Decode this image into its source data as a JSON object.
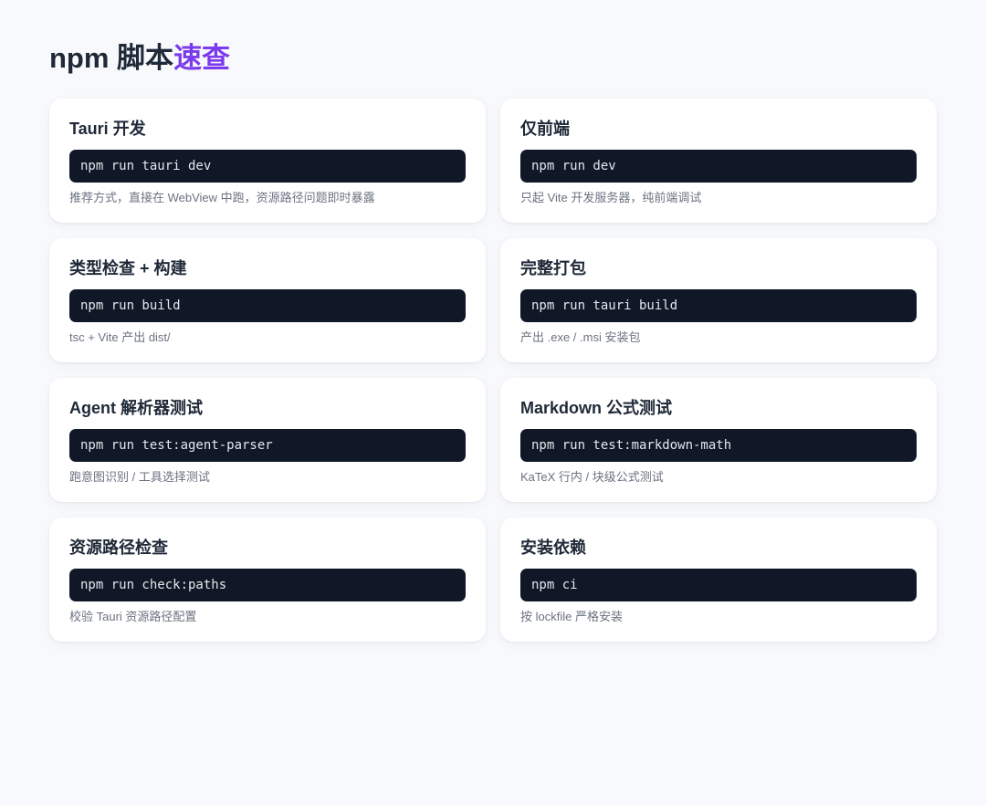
{
  "header": {
    "title_main": "npm 脚本",
    "title_accent": "速查"
  },
  "colors": {
    "accent": "#7c3aed",
    "code_bg": "#101828",
    "page_bg": "#f7f9fc"
  },
  "cards": [
    {
      "title": "Tauri 开发",
      "command": "npm run tauri dev",
      "description": "推荐方式，直接在 WebView 中跑，资源路径问题即时暴露"
    },
    {
      "title": "仅前端",
      "command": "npm run dev",
      "description": "只起 Vite 开发服务器，纯前端调试"
    },
    {
      "title": "类型检查 + 构建",
      "command": "npm run build",
      "description": "tsc + Vite 产出 dist/"
    },
    {
      "title": "完整打包",
      "command": "npm run tauri build",
      "description": "产出 .exe / .msi 安装包"
    },
    {
      "title": "Agent 解析器测试",
      "command": "npm run test:agent-parser",
      "description": "跑意图识别 / 工具选择测试"
    },
    {
      "title": "Markdown 公式测试",
      "command": "npm run test:markdown-math",
      "description": "KaTeX 行内 / 块级公式测试"
    },
    {
      "title": "资源路径检查",
      "command": "npm run check:paths",
      "description": "校验 Tauri 资源路径配置"
    },
    {
      "title": "安装依赖",
      "command": "npm ci",
      "description": "按 lockfile 严格安装"
    }
  ]
}
